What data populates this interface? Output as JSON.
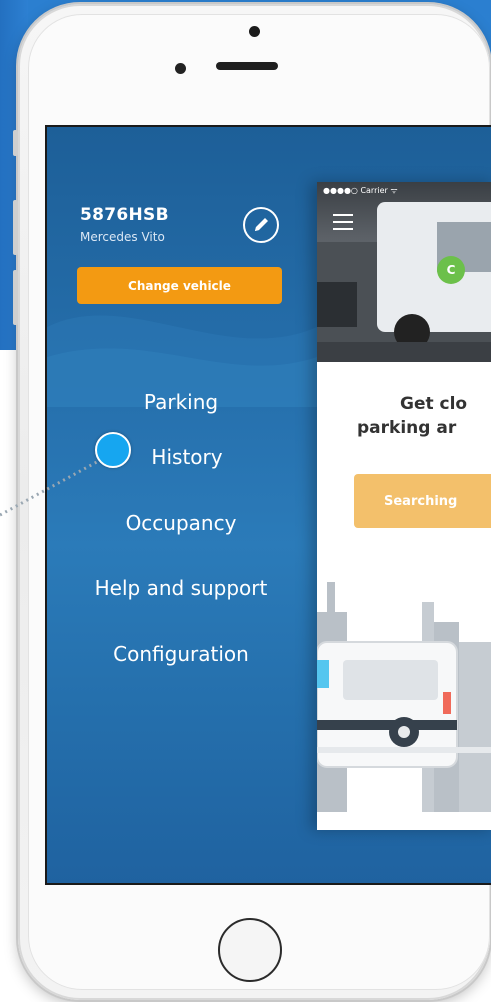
{
  "colors": {
    "drawer_bg": "#2670ad",
    "accent_orange": "#f39a12",
    "search_button": "#f3c06b",
    "marker": "#16a6f0",
    "badge_green": "#6cc04a"
  },
  "status_bar": {
    "carrier": "●●●●○ Carrier ᯤ"
  },
  "vehicle": {
    "plate": "5876HSB",
    "model": "Mercedes Vito",
    "change_label": "Change vehicle",
    "edit_icon": "pencil-icon"
  },
  "menu": {
    "items": [
      {
        "label": "Parking"
      },
      {
        "label": "History"
      },
      {
        "label": "Occupancy"
      },
      {
        "label": "Help and support"
      },
      {
        "label": "Configuration"
      }
    ]
  },
  "main": {
    "badge": "C",
    "headline_line1": "Get clo",
    "headline_line2": "parking ar",
    "search_label": "Searching"
  }
}
